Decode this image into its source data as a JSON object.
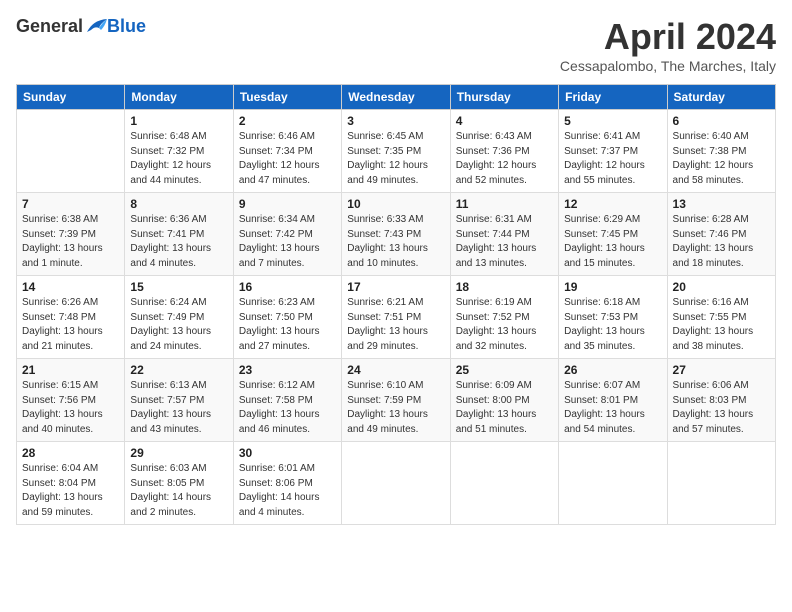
{
  "logo": {
    "general": "General",
    "blue": "Blue"
  },
  "title": "April 2024",
  "location": "Cessapalombo, The Marches, Italy",
  "days_of_week": [
    "Sunday",
    "Monday",
    "Tuesday",
    "Wednesday",
    "Thursday",
    "Friday",
    "Saturday"
  ],
  "weeks": [
    [
      {
        "day": "",
        "info": ""
      },
      {
        "day": "1",
        "info": "Sunrise: 6:48 AM\nSunset: 7:32 PM\nDaylight: 12 hours\nand 44 minutes."
      },
      {
        "day": "2",
        "info": "Sunrise: 6:46 AM\nSunset: 7:34 PM\nDaylight: 12 hours\nand 47 minutes."
      },
      {
        "day": "3",
        "info": "Sunrise: 6:45 AM\nSunset: 7:35 PM\nDaylight: 12 hours\nand 49 minutes."
      },
      {
        "day": "4",
        "info": "Sunrise: 6:43 AM\nSunset: 7:36 PM\nDaylight: 12 hours\nand 52 minutes."
      },
      {
        "day": "5",
        "info": "Sunrise: 6:41 AM\nSunset: 7:37 PM\nDaylight: 12 hours\nand 55 minutes."
      },
      {
        "day": "6",
        "info": "Sunrise: 6:40 AM\nSunset: 7:38 PM\nDaylight: 12 hours\nand 58 minutes."
      }
    ],
    [
      {
        "day": "7",
        "info": "Sunrise: 6:38 AM\nSunset: 7:39 PM\nDaylight: 13 hours\nand 1 minute."
      },
      {
        "day": "8",
        "info": "Sunrise: 6:36 AM\nSunset: 7:41 PM\nDaylight: 13 hours\nand 4 minutes."
      },
      {
        "day": "9",
        "info": "Sunrise: 6:34 AM\nSunset: 7:42 PM\nDaylight: 13 hours\nand 7 minutes."
      },
      {
        "day": "10",
        "info": "Sunrise: 6:33 AM\nSunset: 7:43 PM\nDaylight: 13 hours\nand 10 minutes."
      },
      {
        "day": "11",
        "info": "Sunrise: 6:31 AM\nSunset: 7:44 PM\nDaylight: 13 hours\nand 13 minutes."
      },
      {
        "day": "12",
        "info": "Sunrise: 6:29 AM\nSunset: 7:45 PM\nDaylight: 13 hours\nand 15 minutes."
      },
      {
        "day": "13",
        "info": "Sunrise: 6:28 AM\nSunset: 7:46 PM\nDaylight: 13 hours\nand 18 minutes."
      }
    ],
    [
      {
        "day": "14",
        "info": "Sunrise: 6:26 AM\nSunset: 7:48 PM\nDaylight: 13 hours\nand 21 minutes."
      },
      {
        "day": "15",
        "info": "Sunrise: 6:24 AM\nSunset: 7:49 PM\nDaylight: 13 hours\nand 24 minutes."
      },
      {
        "day": "16",
        "info": "Sunrise: 6:23 AM\nSunset: 7:50 PM\nDaylight: 13 hours\nand 27 minutes."
      },
      {
        "day": "17",
        "info": "Sunrise: 6:21 AM\nSunset: 7:51 PM\nDaylight: 13 hours\nand 29 minutes."
      },
      {
        "day": "18",
        "info": "Sunrise: 6:19 AM\nSunset: 7:52 PM\nDaylight: 13 hours\nand 32 minutes."
      },
      {
        "day": "19",
        "info": "Sunrise: 6:18 AM\nSunset: 7:53 PM\nDaylight: 13 hours\nand 35 minutes."
      },
      {
        "day": "20",
        "info": "Sunrise: 6:16 AM\nSunset: 7:55 PM\nDaylight: 13 hours\nand 38 minutes."
      }
    ],
    [
      {
        "day": "21",
        "info": "Sunrise: 6:15 AM\nSunset: 7:56 PM\nDaylight: 13 hours\nand 40 minutes."
      },
      {
        "day": "22",
        "info": "Sunrise: 6:13 AM\nSunset: 7:57 PM\nDaylight: 13 hours\nand 43 minutes."
      },
      {
        "day": "23",
        "info": "Sunrise: 6:12 AM\nSunset: 7:58 PM\nDaylight: 13 hours\nand 46 minutes."
      },
      {
        "day": "24",
        "info": "Sunrise: 6:10 AM\nSunset: 7:59 PM\nDaylight: 13 hours\nand 49 minutes."
      },
      {
        "day": "25",
        "info": "Sunrise: 6:09 AM\nSunset: 8:00 PM\nDaylight: 13 hours\nand 51 minutes."
      },
      {
        "day": "26",
        "info": "Sunrise: 6:07 AM\nSunset: 8:01 PM\nDaylight: 13 hours\nand 54 minutes."
      },
      {
        "day": "27",
        "info": "Sunrise: 6:06 AM\nSunset: 8:03 PM\nDaylight: 13 hours\nand 57 minutes."
      }
    ],
    [
      {
        "day": "28",
        "info": "Sunrise: 6:04 AM\nSunset: 8:04 PM\nDaylight: 13 hours\nand 59 minutes."
      },
      {
        "day": "29",
        "info": "Sunrise: 6:03 AM\nSunset: 8:05 PM\nDaylight: 14 hours\nand 2 minutes."
      },
      {
        "day": "30",
        "info": "Sunrise: 6:01 AM\nSunset: 8:06 PM\nDaylight: 14 hours\nand 4 minutes."
      },
      {
        "day": "",
        "info": ""
      },
      {
        "day": "",
        "info": ""
      },
      {
        "day": "",
        "info": ""
      },
      {
        "day": "",
        "info": ""
      }
    ]
  ]
}
